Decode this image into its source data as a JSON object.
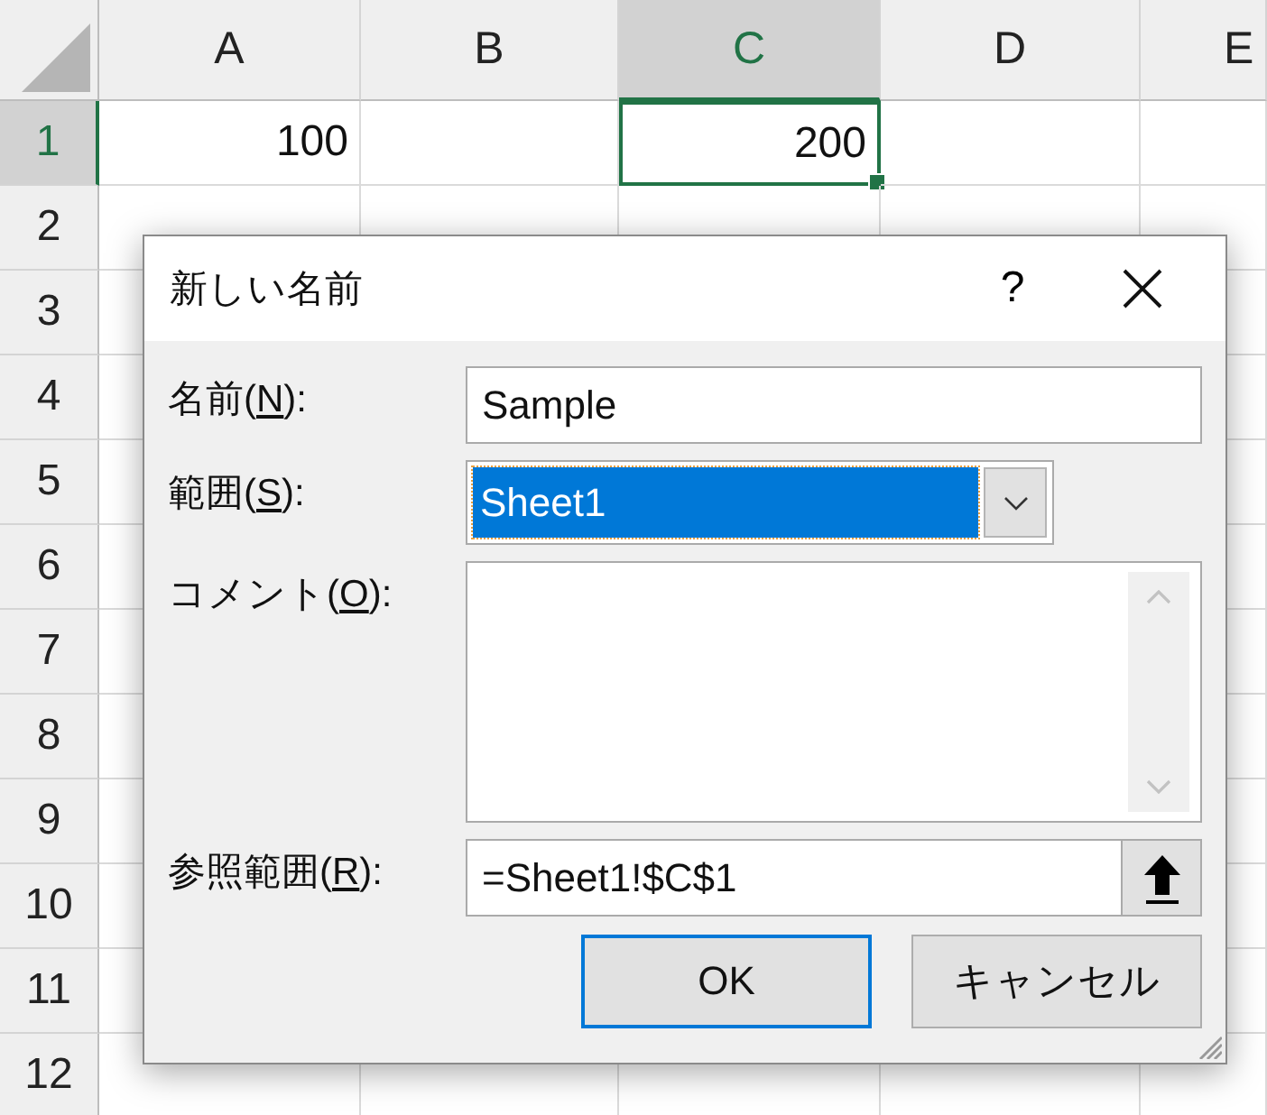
{
  "sheet": {
    "columns": [
      {
        "label": "A",
        "selected": false
      },
      {
        "label": "B",
        "selected": false
      },
      {
        "label": "C",
        "selected": true
      },
      {
        "label": "D",
        "selected": false
      },
      {
        "label": "E",
        "selected": false
      }
    ],
    "rows": [
      {
        "label": "1",
        "selected": true,
        "cells": [
          {
            "kind": "value",
            "value": "100",
            "selected": false
          },
          {
            "kind": "empty",
            "selected": false
          },
          {
            "kind": "value",
            "value": "200",
            "selected": true
          },
          {
            "kind": "empty",
            "selected": false
          }
        ]
      },
      {
        "label": "2",
        "selected": false
      },
      {
        "label": "3",
        "selected": false
      },
      {
        "label": "4",
        "selected": false
      },
      {
        "label": "5",
        "selected": false
      },
      {
        "label": "6",
        "selected": false
      },
      {
        "label": "7",
        "selected": false
      },
      {
        "label": "8",
        "selected": false
      },
      {
        "label": "9",
        "selected": false
      },
      {
        "label": "10",
        "selected": false
      },
      {
        "label": "11",
        "selected": false
      },
      {
        "label": "12",
        "selected": false
      }
    ]
  },
  "dialog": {
    "title": "新しい名前",
    "help": "?",
    "fields": [
      {
        "kind": "text",
        "label": {
          "before": "名前(",
          "key": "N",
          "after": "):"
        },
        "value": "Sample"
      },
      {
        "kind": "dropdown",
        "label": {
          "before": "範囲(",
          "key": "S",
          "after": "):"
        },
        "value": "Sheet1"
      },
      {
        "kind": "textarea",
        "label": {
          "before": "コメント(",
          "key": "O",
          "after": "):"
        }
      },
      {
        "kind": "reference",
        "label": {
          "before": "参照範囲(",
          "key": "R",
          "after": "):"
        },
        "value": "=Sheet1!$C$1"
      }
    ],
    "buttons": [
      {
        "label": "OK",
        "default": true
      },
      {
        "label": "キャンセル",
        "default": false
      }
    ]
  }
}
